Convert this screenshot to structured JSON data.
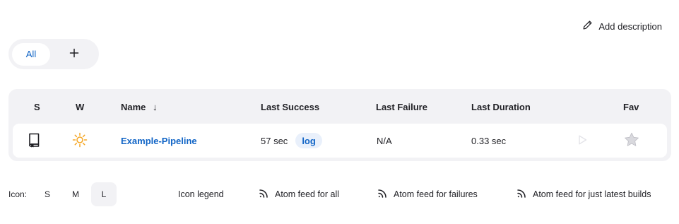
{
  "header": {
    "add_description_label": "Add description",
    "add_description_icon": "pencil-icon"
  },
  "tabs": {
    "all_label": "All",
    "add_tab_symbol": "+",
    "add_tab_icon": "plus-icon"
  },
  "table": {
    "columns": {
      "s": "S",
      "w": "W",
      "name": "Name",
      "name_sort_indicator": "↓",
      "last_success": "Last Success",
      "last_failure": "Last Failure",
      "last_duration": "Last Duration",
      "fav": "Fav"
    },
    "rows": [
      {
        "status_icon": "notebook-icon",
        "weather_icon": "sun-icon",
        "name": "Example-Pipeline",
        "last_success": "57 sec",
        "log_label": "log",
        "last_failure": "N/A",
        "last_duration": "0.33 sec",
        "build_icon": "play-icon",
        "fav_icon": "star-icon"
      }
    ]
  },
  "footer": {
    "icon_label": "Icon:",
    "sizes": [
      "S",
      "M",
      "L"
    ],
    "selected_size": "L",
    "icon_legend_label": "Icon legend",
    "feed_all_label": "Atom feed for all",
    "feed_failures_label": "Atom feed for failures",
    "feed_latest_label": "Atom feed for just latest builds",
    "feed_icon": "rss-icon"
  },
  "colors": {
    "accent": "#1064c6",
    "weather_sun": "#f5a623",
    "panel_bg": "#f2f2f5",
    "badge_bg": "#e9f0fb"
  }
}
